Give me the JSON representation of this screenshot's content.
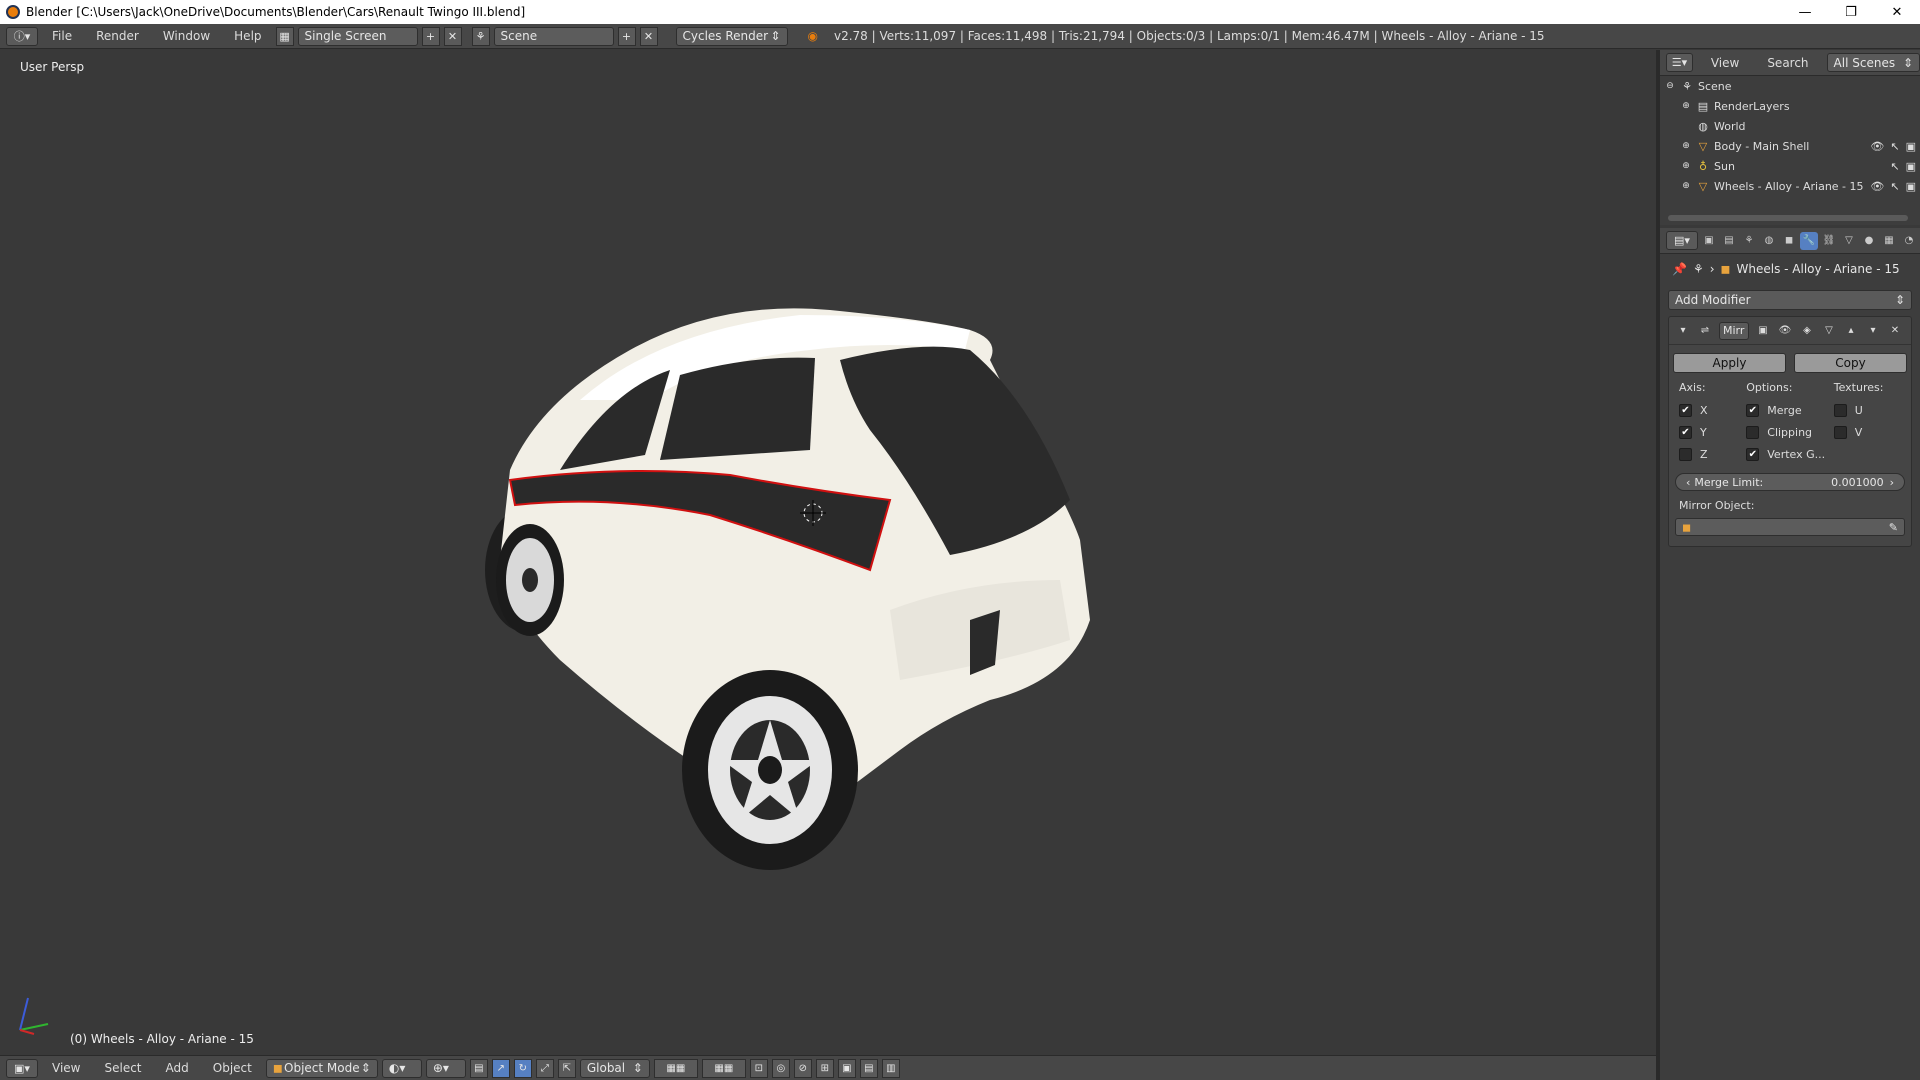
{
  "window": {
    "title": "Blender [C:\\Users\\Jack\\OneDrive\\Documents\\Blender\\Cars\\Renault Twingo III.blend]",
    "minimize": "—",
    "restore": "❐",
    "close": "✕"
  },
  "infobar": {
    "menus": [
      "File",
      "Render",
      "Window",
      "Help"
    ],
    "layout": "Single Screen",
    "scene": "Scene",
    "engine": "Cycles Render",
    "stats": "v2.78 | Verts:11,097 | Faces:11,498 | Tris:21,794 | Objects:0/3 | Lamps:0/1 | Mem:46.47M | Wheels - Alloy - Ariane - 15"
  },
  "viewport": {
    "view_label": "User Persp",
    "object_label": "(0) Wheels - Alloy - Ariane - 15"
  },
  "outliner": {
    "menus": [
      "View",
      "Search"
    ],
    "filter": "All Scenes",
    "items": [
      {
        "label": "Scene",
        "icon": "scene-icon"
      },
      {
        "label": "RenderLayers",
        "icon": "renderlayers-icon"
      },
      {
        "label": "World",
        "icon": "world-icon"
      },
      {
        "label": "Body - Main Shell",
        "icon": "mesh-icon"
      },
      {
        "label": "Sun",
        "icon": "lamp-icon"
      },
      {
        "label": "Wheels - Alloy - Ariane - 15",
        "icon": "mesh-icon"
      }
    ]
  },
  "properties": {
    "breadcrumb_object": "Wheels - Alloy - Ariane - 15",
    "add_modifier": "Add Modifier",
    "modifier": {
      "name": "Mirr",
      "apply": "Apply",
      "copy": "Copy",
      "axis_label": "Axis:",
      "options_label": "Options:",
      "textures_label": "Textures:",
      "axis": [
        {
          "label": "X",
          "checked": true
        },
        {
          "label": "Y",
          "checked": true
        },
        {
          "label": "Z",
          "checked": false
        }
      ],
      "options": [
        {
          "label": "Merge",
          "checked": true
        },
        {
          "label": "Clipping",
          "checked": false
        },
        {
          "label": "Vertex G...",
          "checked": true
        }
      ],
      "textures": [
        {
          "label": "U",
          "checked": false
        },
        {
          "label": "V",
          "checked": false
        }
      ],
      "merge_limit_label": "Merge Limit:",
      "merge_limit_value": "0.001000",
      "mirror_object_label": "Mirror Object:"
    }
  },
  "bottombar": {
    "menus": [
      "View",
      "Select",
      "Add",
      "Object"
    ],
    "mode": "Object Mode",
    "orientation": "Global"
  },
  "colors": {
    "accent": "#5680c2",
    "background": "#393939",
    "header": "#474747",
    "car_body": "#f2efe6",
    "car_stripe": "#2a2a2a",
    "selection_outline": "#d01010"
  }
}
